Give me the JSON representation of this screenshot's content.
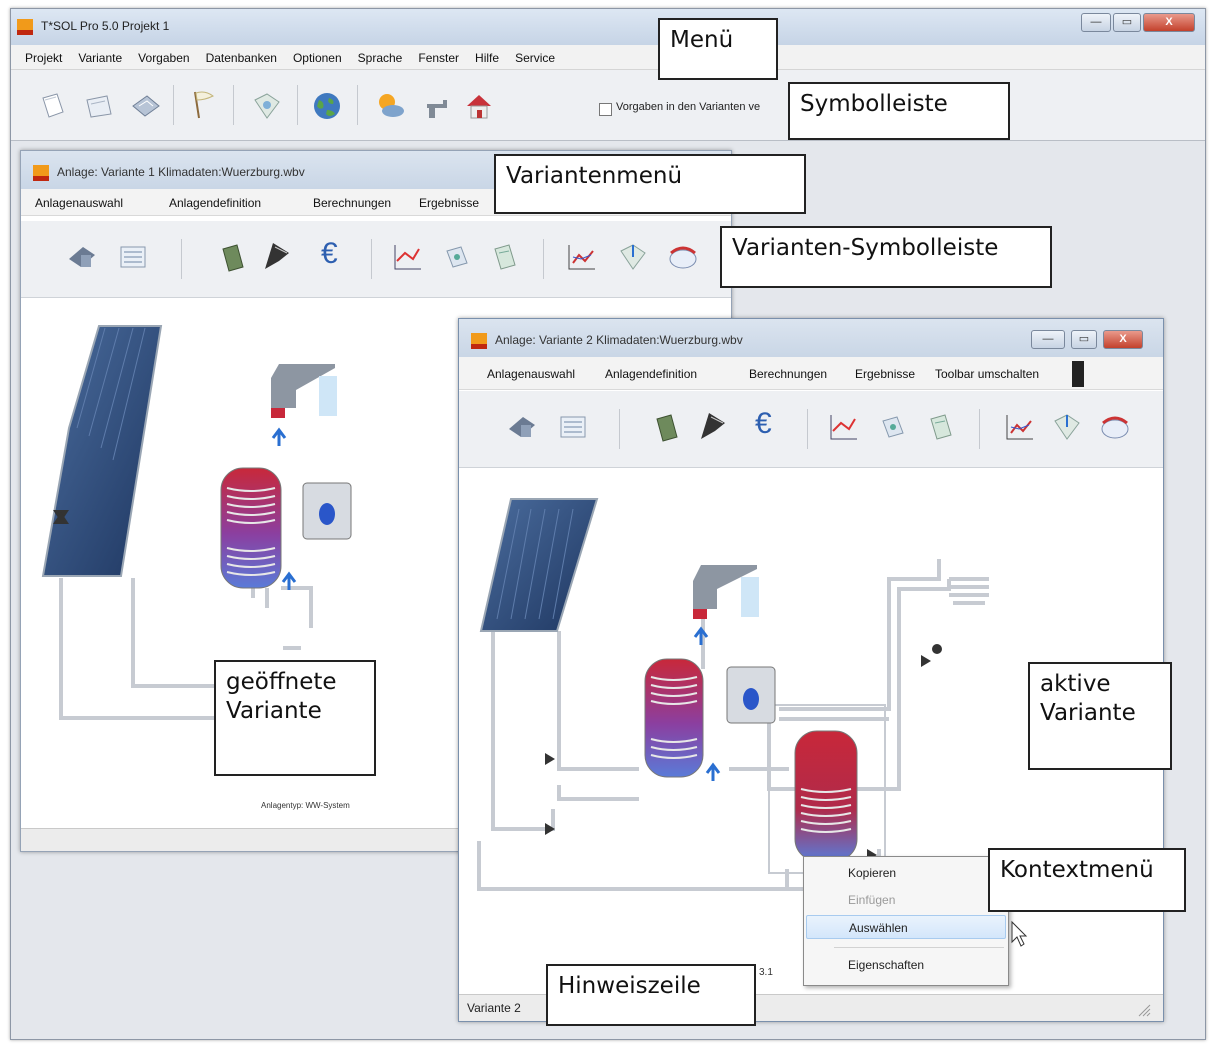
{
  "main_window": {
    "title": "T*SOL Pro 5.0 Projekt 1",
    "controls": [
      "—",
      "▭",
      "X"
    ],
    "menu": [
      "Projekt",
      "Variante",
      "Vorgaben",
      "Datenbanken",
      "Optionen",
      "Sprache",
      "Fenster",
      "Hilfe",
      "Service"
    ],
    "toolbar": {
      "icons": [
        "new-file-icon",
        "open-folder-icon",
        "save-icon",
        "flag-icon",
        "map-icon",
        "globe-icon",
        "weather-icon",
        "faucet-icon",
        "house-icon"
      ],
      "checkbox_label": "Vorgaben in den Varianten ve"
    }
  },
  "variant1": {
    "title": "Anlage: Variante 1   Klimadaten:Wuerzburg.wbv",
    "menu": [
      "Anlagenauswahl",
      "Anlagendefinition",
      "Berechnungen",
      "Ergebnisse"
    ],
    "system_label": "Anlagentyp: WW-System"
  },
  "variant2": {
    "title": "Anlage: Variante 2   Klimadaten:Wuerzburg.wbv",
    "menu": [
      "Anlagenauswahl",
      "Anlagendefinition",
      "Berechnungen",
      "Ergebnisse",
      "Toolbar umschalten"
    ],
    "status_text": "Variante 2",
    "status_extra": "3.1"
  },
  "variant_toolbar_icons": [
    "system-select-icon",
    "system-define-icon",
    "calculator-icon",
    "collector-icon",
    "euro-icon",
    "chart-icon",
    "report-icon",
    "report2-icon",
    "results-chart-icon",
    "map2-icon",
    "enev-icon"
  ],
  "context_menu": {
    "items": [
      {
        "label": "Kopieren",
        "state": "normal"
      },
      {
        "label": "Einfügen",
        "state": "disabled"
      },
      {
        "label": "Auswählen",
        "state": "highlighted"
      },
      {
        "label": "Eigenschaften",
        "state": "normal"
      }
    ]
  },
  "callouts": {
    "menu": "Menü",
    "toolbar": "Symbolleiste",
    "variant_menu": "Variantenmenü",
    "variant_toolbar": "Varianten-Symbolleiste",
    "opened_variant": "geöffnete\nVariante",
    "active_variant": "aktive\nVariante",
    "context_menu": "Kontextmenü",
    "hint_line": "Hinweiszeile"
  },
  "colors": {
    "title_gradient": "#c9d6e6",
    "close_red": "#c3412c",
    "tank_red": "#c8283a",
    "tank_blue": "#6a7bd0",
    "collector_blue": "#2d4f86",
    "arrow_blue": "#2a6fd1"
  }
}
